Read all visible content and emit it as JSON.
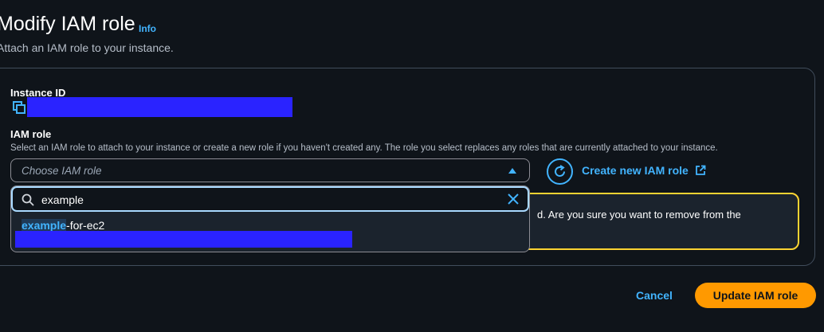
{
  "header": {
    "title": "Modify IAM role",
    "info_link": "Info",
    "subtitle": "Attach an IAM role to your instance."
  },
  "instance": {
    "label": "Instance ID"
  },
  "iam_role": {
    "label": "IAM role",
    "description": "Select an IAM role to attach to your instance or create a new role if you haven't created any. The role you select replaces any roles that are currently attached to your instance.",
    "placeholder": "Choose IAM role",
    "create_link": "Create new IAM role"
  },
  "dropdown": {
    "search_value": "example",
    "options": [
      {
        "match": "example",
        "rest": "-for-ec2"
      }
    ]
  },
  "warning": {
    "text": "d. Are you sure you want to remove from the"
  },
  "footer": {
    "cancel_label": "Cancel",
    "submit_label": "Update IAM role"
  },
  "colors": {
    "accent": "#42b4ff",
    "primary_button": "#ff9900",
    "warning_border": "#fbd332",
    "redaction": "#2a23ff"
  }
}
